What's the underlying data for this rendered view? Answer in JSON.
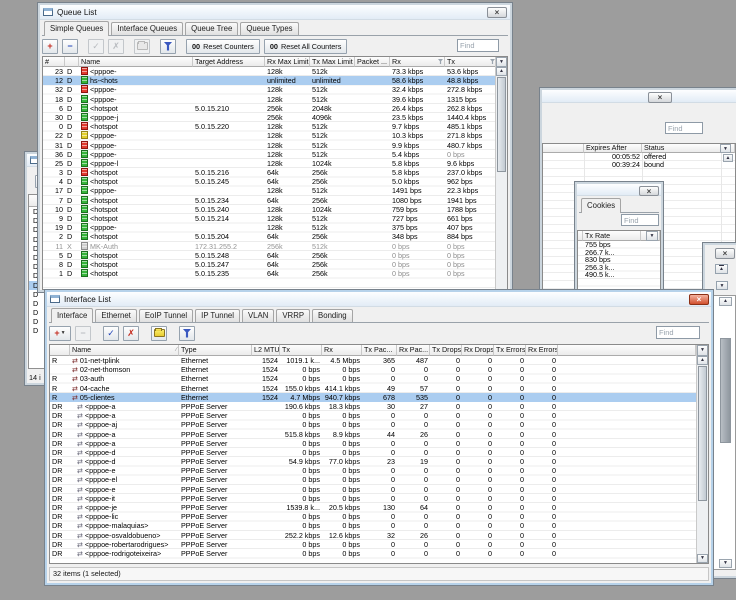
{
  "colors": {
    "desktop": "#9d9d9d",
    "selection": "#abcdf0",
    "window_bg": "#f0f0f0",
    "active_frame": "#b6d2ea",
    "inactive_frame": "#ccd6de",
    "close_red": "#d14f2e",
    "accent_red": "#c42a1e",
    "accent_blue": "#2446b8",
    "folder_yellow": "#e8cc30",
    "disabled_text": "#949494"
  },
  "icons": {
    "add": "+",
    "remove": "−",
    "enable": "✓",
    "disable": "✗",
    "dropdown": "▼",
    "scroll_up": "▲",
    "scroll_down": "▼",
    "sort_asc": "∕",
    "interface": "⇄",
    "counter": "00"
  },
  "left_window": {
    "flags": [
      "D",
      "D",
      "D",
      "D",
      "D",
      "D",
      "D",
      "D",
      "D",
      "D",
      "D",
      "D",
      "D",
      "D"
    ],
    "selected_index": 8,
    "status": "14 i"
  },
  "queue_list": {
    "title": "Queue List",
    "tabs": [
      "Simple Queues",
      "Interface Queues",
      "Queue Tree",
      "Queue Types"
    ],
    "active_tab": "Simple Queues",
    "toolbar": {
      "counter_glyph": "00",
      "reset_counters": "Reset Counters",
      "reset_all_counters": "Reset All Counters"
    },
    "find": "Find",
    "columns": [
      "#",
      "",
      "Name",
      "Target Address",
      "Rx Max Limit",
      "Tx Max Limit",
      "Packet ...",
      "Rx",
      "Tx"
    ],
    "rows": [
      {
        "num": "23",
        "flag": "D",
        "icon": "red",
        "name": "<pppoe-",
        "target": "",
        "rx_max": "128k",
        "tx_max": "512k",
        "packet": "",
        "rx": "73.3 kbps",
        "tx": "53.6 kbps"
      },
      {
        "num": "12",
        "flag": "D",
        "icon": "green",
        "name": "hs-<hots",
        "target": "",
        "rx_max": "unlimited",
        "tx_max": "unlimited",
        "packet": "",
        "rx": "58.6 kbps",
        "tx": "48.8 kbps",
        "selected": true
      },
      {
        "num": "32",
        "flag": "D",
        "icon": "red",
        "name": "<pppoe-",
        "target": "",
        "rx_max": "128k",
        "tx_max": "512k",
        "packet": "",
        "rx": "32.4 kbps",
        "tx": "272.8 kbps"
      },
      {
        "num": "18",
        "flag": "D",
        "icon": "green",
        "name": "<pppoe-",
        "target": "",
        "rx_max": "128k",
        "tx_max": "512k",
        "packet": "",
        "rx": "39.6 kbps",
        "tx": "1315 bps"
      },
      {
        "num": "6",
        "flag": "D",
        "icon": "green",
        "name": "<hotspot",
        "target": "5.0.15.210",
        "rx_max": "256k",
        "tx_max": "2048k",
        "packet": "",
        "rx": "26.4 kbps",
        "tx": "262.8 kbps"
      },
      {
        "num": "30",
        "flag": "D",
        "icon": "green",
        "name": "<pppoe-j",
        "target": "",
        "rx_max": "256k",
        "tx_max": "4096k",
        "packet": "",
        "rx": "23.5 kbps",
        "tx": "1440.4 kbps"
      },
      {
        "num": "0",
        "flag": "D",
        "icon": "red",
        "name": "<hotspot",
        "target": "5.0.15.220",
        "rx_max": "128k",
        "tx_max": "512k",
        "packet": "",
        "rx": "9.7 kbps",
        "tx": "485.1 kbps"
      },
      {
        "num": "22",
        "flag": "D",
        "icon": "yellow",
        "name": "<pppoe-",
        "target": "",
        "rx_max": "128k",
        "tx_max": "512k",
        "packet": "",
        "rx": "10.3 kbps",
        "tx": "271.8 kbps"
      },
      {
        "num": "31",
        "flag": "D",
        "icon": "red",
        "name": "<pppoe-",
        "target": "",
        "rx_max": "128k",
        "tx_max": "512k",
        "packet": "",
        "rx": "9.9 kbps",
        "tx": "480.7 kbps"
      },
      {
        "num": "36",
        "flag": "D",
        "icon": "green",
        "name": "<pppoe-",
        "target": "",
        "rx_max": "128k",
        "tx_max": "512k",
        "packet": "",
        "rx": "5.4 kbps",
        "tx": "0 bps"
      },
      {
        "num": "25",
        "flag": "D",
        "icon": "green",
        "name": "<pppoe-l",
        "target": "",
        "rx_max": "128k",
        "tx_max": "1024k",
        "packet": "",
        "rx": "5.8 kbps",
        "tx": "9.6 kbps"
      },
      {
        "num": "3",
        "flag": "D",
        "icon": "red",
        "name": "<hotspot",
        "target": "5.0.15.216",
        "rx_max": "64k",
        "tx_max": "256k",
        "packet": "",
        "rx": "5.8 kbps",
        "tx": "237.0 kbps"
      },
      {
        "num": "4",
        "flag": "D",
        "icon": "green",
        "name": "<hotspot",
        "target": "5.0.15.245",
        "rx_max": "64k",
        "tx_max": "256k",
        "packet": "",
        "rx": "5.0 kbps",
        "tx": "962 bps"
      },
      {
        "num": "17",
        "flag": "D",
        "icon": "green",
        "name": "<pppoe-",
        "target": "",
        "rx_max": "128k",
        "tx_max": "512k",
        "packet": "",
        "rx": "1491 bps",
        "tx": "22.3 kbps"
      },
      {
        "num": "7",
        "flag": "D",
        "icon": "green",
        "name": "<hotspot",
        "target": "5.0.15.234",
        "rx_max": "64k",
        "tx_max": "256k",
        "packet": "",
        "rx": "1080 bps",
        "tx": "1941 bps"
      },
      {
        "num": "10",
        "flag": "D",
        "icon": "green",
        "name": "<hotspot",
        "target": "5.0.15.240",
        "rx_max": "128k",
        "tx_max": "1024k",
        "packet": "",
        "rx": "759 bps",
        "tx": "1788 bps"
      },
      {
        "num": "9",
        "flag": "D",
        "icon": "green",
        "name": "<hotspot",
        "target": "5.0.15.214",
        "rx_max": "128k",
        "tx_max": "512k",
        "packet": "",
        "rx": "727 bps",
        "tx": "661 bps"
      },
      {
        "num": "19",
        "flag": "D",
        "icon": "green",
        "name": "<pppoe-",
        "target": "",
        "rx_max": "128k",
        "tx_max": "512k",
        "packet": "",
        "rx": "375 bps",
        "tx": "407 bps"
      },
      {
        "num": "2",
        "flag": "D",
        "icon": "green",
        "name": "<hotspot",
        "target": "5.0.15.204",
        "rx_max": "64k",
        "tx_max": "256k",
        "packet": "",
        "rx": "348 bps",
        "tx": "884 bps"
      },
      {
        "num": "11",
        "flag": "X",
        "icon": "gray",
        "name": "MK-Auth",
        "target": "172.31.255.2",
        "rx_max": "256k",
        "tx_max": "512k",
        "packet": "",
        "rx": "0 bps",
        "tx": "0 bps",
        "disabled": true
      },
      {
        "num": "5",
        "flag": "D",
        "icon": "green",
        "name": "<hotspot",
        "target": "5.0.15.248",
        "rx_max": "64k",
        "tx_max": "256k",
        "packet": "",
        "rx": "0 bps",
        "tx": "0 bps"
      },
      {
        "num": "8",
        "flag": "D",
        "icon": "green",
        "name": "<hotspot",
        "target": "5.0.15.247",
        "rx_max": "64k",
        "tx_max": "256k",
        "packet": "",
        "rx": "0 bps",
        "tx": "0 bps"
      },
      {
        "num": "1",
        "flag": "D",
        "icon": "green",
        "name": "<hotspot",
        "target": "5.0.15.235",
        "rx_max": "64k",
        "tx_max": "256k",
        "packet": "",
        "rx": "0 bps",
        "tx": "0 bps"
      }
    ]
  },
  "dhcp_leases": {
    "find": "Find",
    "columns": [
      "",
      "Expires After",
      "Status"
    ],
    "rows": [
      {
        "expires": "00:05:52",
        "status": "offered"
      },
      {
        "expires": "00:39:24",
        "status": "bound",
        "selected": true
      }
    ]
  },
  "hotspot_cookies": {
    "tab": "Cookies",
    "find": "Find",
    "column": "Tx Rate",
    "rows": [
      {
        "value": "755 bps"
      },
      {
        "value": "266.7 k..."
      },
      {
        "value": "830 bps",
        "selected": true
      },
      {
        "value": "256.3 k..."
      },
      {
        "value": "490.5 k..."
      }
    ]
  },
  "interface_list": {
    "title": "Interface List",
    "tabs": [
      "Interface",
      "Ethernet",
      "EoIP Tunnel",
      "IP Tunnel",
      "VLAN",
      "VRRP",
      "Bonding"
    ],
    "active_tab": "Interface",
    "find": "Find",
    "columns": [
      "",
      "Name",
      "Type",
      "L2 MTU",
      "Tx",
      "Rx",
      "Tx Pac...",
      "Rx Pac...",
      "Tx Drops",
      "Rx Drops",
      "Tx Errors",
      "Rx Errors"
    ],
    "status": "32 items (1 selected)",
    "rows": [
      {
        "flags": "R",
        "name": "01-net-tplink",
        "type": "Ethernet",
        "l2mtu": "1524",
        "tx": "1019.1 k...",
        "rx": "4.5 Mbps",
        "txp": "365",
        "rxp": "487",
        "txd": "0",
        "rxd": "0",
        "txe": "0",
        "rxe": "0"
      },
      {
        "flags": "",
        "name": "02-net-thomson",
        "type": "Ethernet",
        "l2mtu": "1524",
        "tx": "0 bps",
        "rx": "0 bps",
        "txp": "0",
        "rxp": "0",
        "txd": "0",
        "rxd": "0",
        "txe": "0",
        "rxe": "0"
      },
      {
        "flags": "R",
        "name": "03-auth",
        "type": "Ethernet",
        "l2mtu": "1524",
        "tx": "0 bps",
        "rx": "0 bps",
        "txp": "0",
        "rxp": "0",
        "txd": "0",
        "rxd": "0",
        "txe": "0",
        "rxe": "0"
      },
      {
        "flags": "R",
        "name": "04-cache",
        "type": "Ethernet",
        "l2mtu": "1524",
        "tx": "155.0 kbps",
        "rx": "414.1 kbps",
        "txp": "49",
        "rxp": "57",
        "txd": "0",
        "rxd": "0",
        "txe": "0",
        "rxe": "0"
      },
      {
        "flags": "R",
        "name": "05-clientes",
        "type": "Ethernet",
        "l2mtu": "1524",
        "tx": "4.7 Mbps",
        "rx": "940.7 kbps",
        "txp": "678",
        "rxp": "535",
        "txd": "0",
        "rxd": "0",
        "txe": "0",
        "rxe": "0",
        "selected": true
      },
      {
        "flags": "DR",
        "name": "<pppoe-a",
        "type": "PPPoE Server",
        "l2mtu": "",
        "tx": "190.6 kbps",
        "rx": "18.3 kbps",
        "txp": "30",
        "rxp": "27",
        "txd": "0",
        "rxd": "0",
        "txe": "0",
        "rxe": "0",
        "dynamic": true
      },
      {
        "flags": "DR",
        "name": "<pppoe-a",
        "type": "PPPoE Server",
        "l2mtu": "",
        "tx": "0 bps",
        "rx": "0 bps",
        "txp": "0",
        "rxp": "0",
        "txd": "0",
        "rxd": "0",
        "txe": "0",
        "rxe": "0",
        "dynamic": true
      },
      {
        "flags": "DR",
        "name": "<pppoe-aj",
        "type": "PPPoE Server",
        "l2mtu": "",
        "tx": "0 bps",
        "rx": "0 bps",
        "txp": "0",
        "rxp": "0",
        "txd": "0",
        "rxd": "0",
        "txe": "0",
        "rxe": "0",
        "dynamic": true
      },
      {
        "flags": "DR",
        "name": "<pppoe-a",
        "type": "PPPoE Server",
        "l2mtu": "",
        "tx": "515.8 kbps",
        "rx": "8.9 kbps",
        "txp": "44",
        "rxp": "26",
        "txd": "0",
        "rxd": "0",
        "txe": "0",
        "rxe": "0",
        "dynamic": true
      },
      {
        "flags": "DR",
        "name": "<pppoe-a",
        "type": "PPPoE Server",
        "l2mtu": "",
        "tx": "0 bps",
        "rx": "0 bps",
        "txp": "0",
        "rxp": "0",
        "txd": "0",
        "rxd": "0",
        "txe": "0",
        "rxe": "0",
        "dynamic": true
      },
      {
        "flags": "DR",
        "name": "<pppoe-d",
        "type": "PPPoE Server",
        "l2mtu": "",
        "tx": "0 bps",
        "rx": "0 bps",
        "txp": "0",
        "rxp": "0",
        "txd": "0",
        "rxd": "0",
        "txe": "0",
        "rxe": "0",
        "dynamic": true
      },
      {
        "flags": "DR",
        "name": "<pppoe-d",
        "type": "PPPoE Server",
        "l2mtu": "",
        "tx": "54.9 kbps",
        "rx": "77.0 kbps",
        "txp": "23",
        "rxp": "19",
        "txd": "0",
        "rxd": "0",
        "txe": "0",
        "rxe": "0",
        "dynamic": true
      },
      {
        "flags": "DR",
        "name": "<pppoe-e",
        "type": "PPPoE Server",
        "l2mtu": "",
        "tx": "0 bps",
        "rx": "0 bps",
        "txp": "0",
        "rxp": "0",
        "txd": "0",
        "rxd": "0",
        "txe": "0",
        "rxe": "0",
        "dynamic": true
      },
      {
        "flags": "DR",
        "name": "<pppoe-el",
        "type": "PPPoE Server",
        "l2mtu": "",
        "tx": "0 bps",
        "rx": "0 bps",
        "txp": "0",
        "rxp": "0",
        "txd": "0",
        "rxd": "0",
        "txe": "0",
        "rxe": "0",
        "dynamic": true
      },
      {
        "flags": "DR",
        "name": "<pppoe-e",
        "type": "PPPoE Server",
        "l2mtu": "",
        "tx": "0 bps",
        "rx": "0 bps",
        "txp": "0",
        "rxp": "0",
        "txd": "0",
        "rxd": "0",
        "txe": "0",
        "rxe": "0",
        "dynamic": true
      },
      {
        "flags": "DR",
        "name": "<pppoe-it",
        "type": "PPPoE Server",
        "l2mtu": "",
        "tx": "0 bps",
        "rx": "0 bps",
        "txp": "0",
        "rxp": "0",
        "txd": "0",
        "rxd": "0",
        "txe": "0",
        "rxe": "0",
        "dynamic": true
      },
      {
        "flags": "DR",
        "name": "<pppoe-je",
        "type": "PPPoE Server",
        "l2mtu": "",
        "tx": "1539.8 k...",
        "rx": "20.5 kbps",
        "txp": "130",
        "rxp": "64",
        "txd": "0",
        "rxd": "0",
        "txe": "0",
        "rxe": "0",
        "dynamic": true
      },
      {
        "flags": "DR",
        "name": "<pppoe-lic",
        "type": "PPPoE Server",
        "l2mtu": "",
        "tx": "0 bps",
        "rx": "0 bps",
        "txp": "0",
        "rxp": "0",
        "txd": "0",
        "rxd": "0",
        "txe": "0",
        "rxe": "0",
        "dynamic": true
      },
      {
        "flags": "DR",
        "name": "<pppoe-malaquias>",
        "type": "PPPoE Server",
        "l2mtu": "",
        "tx": "0 bps",
        "rx": "0 bps",
        "txp": "0",
        "rxp": "0",
        "txd": "0",
        "rxd": "0",
        "txe": "0",
        "rxe": "0",
        "dynamic": true
      },
      {
        "flags": "DR",
        "name": "<pppoe-osvaldobueno>",
        "type": "PPPoE Server",
        "l2mtu": "",
        "tx": "252.2 kbps",
        "rx": "12.6 kbps",
        "txp": "32",
        "rxp": "26",
        "txd": "0",
        "rxd": "0",
        "txe": "0",
        "rxe": "0",
        "dynamic": true
      },
      {
        "flags": "DR",
        "name": "<pppoe-robertarodrigues>",
        "type": "PPPoE Server",
        "l2mtu": "",
        "tx": "0 bps",
        "rx": "0 bps",
        "txp": "0",
        "rxp": "0",
        "txd": "0",
        "rxd": "0",
        "txe": "0",
        "rxe": "0",
        "dynamic": true
      },
      {
        "flags": "DR",
        "name": "<pppoe-rodrigoteixeira>",
        "type": "PPPoE Server",
        "l2mtu": "",
        "tx": "0 bps",
        "rx": "0 bps",
        "txp": "0",
        "rxp": "0",
        "txd": "0",
        "rxd": "0",
        "txe": "0",
        "rxe": "0",
        "dynamic": true
      }
    ]
  }
}
